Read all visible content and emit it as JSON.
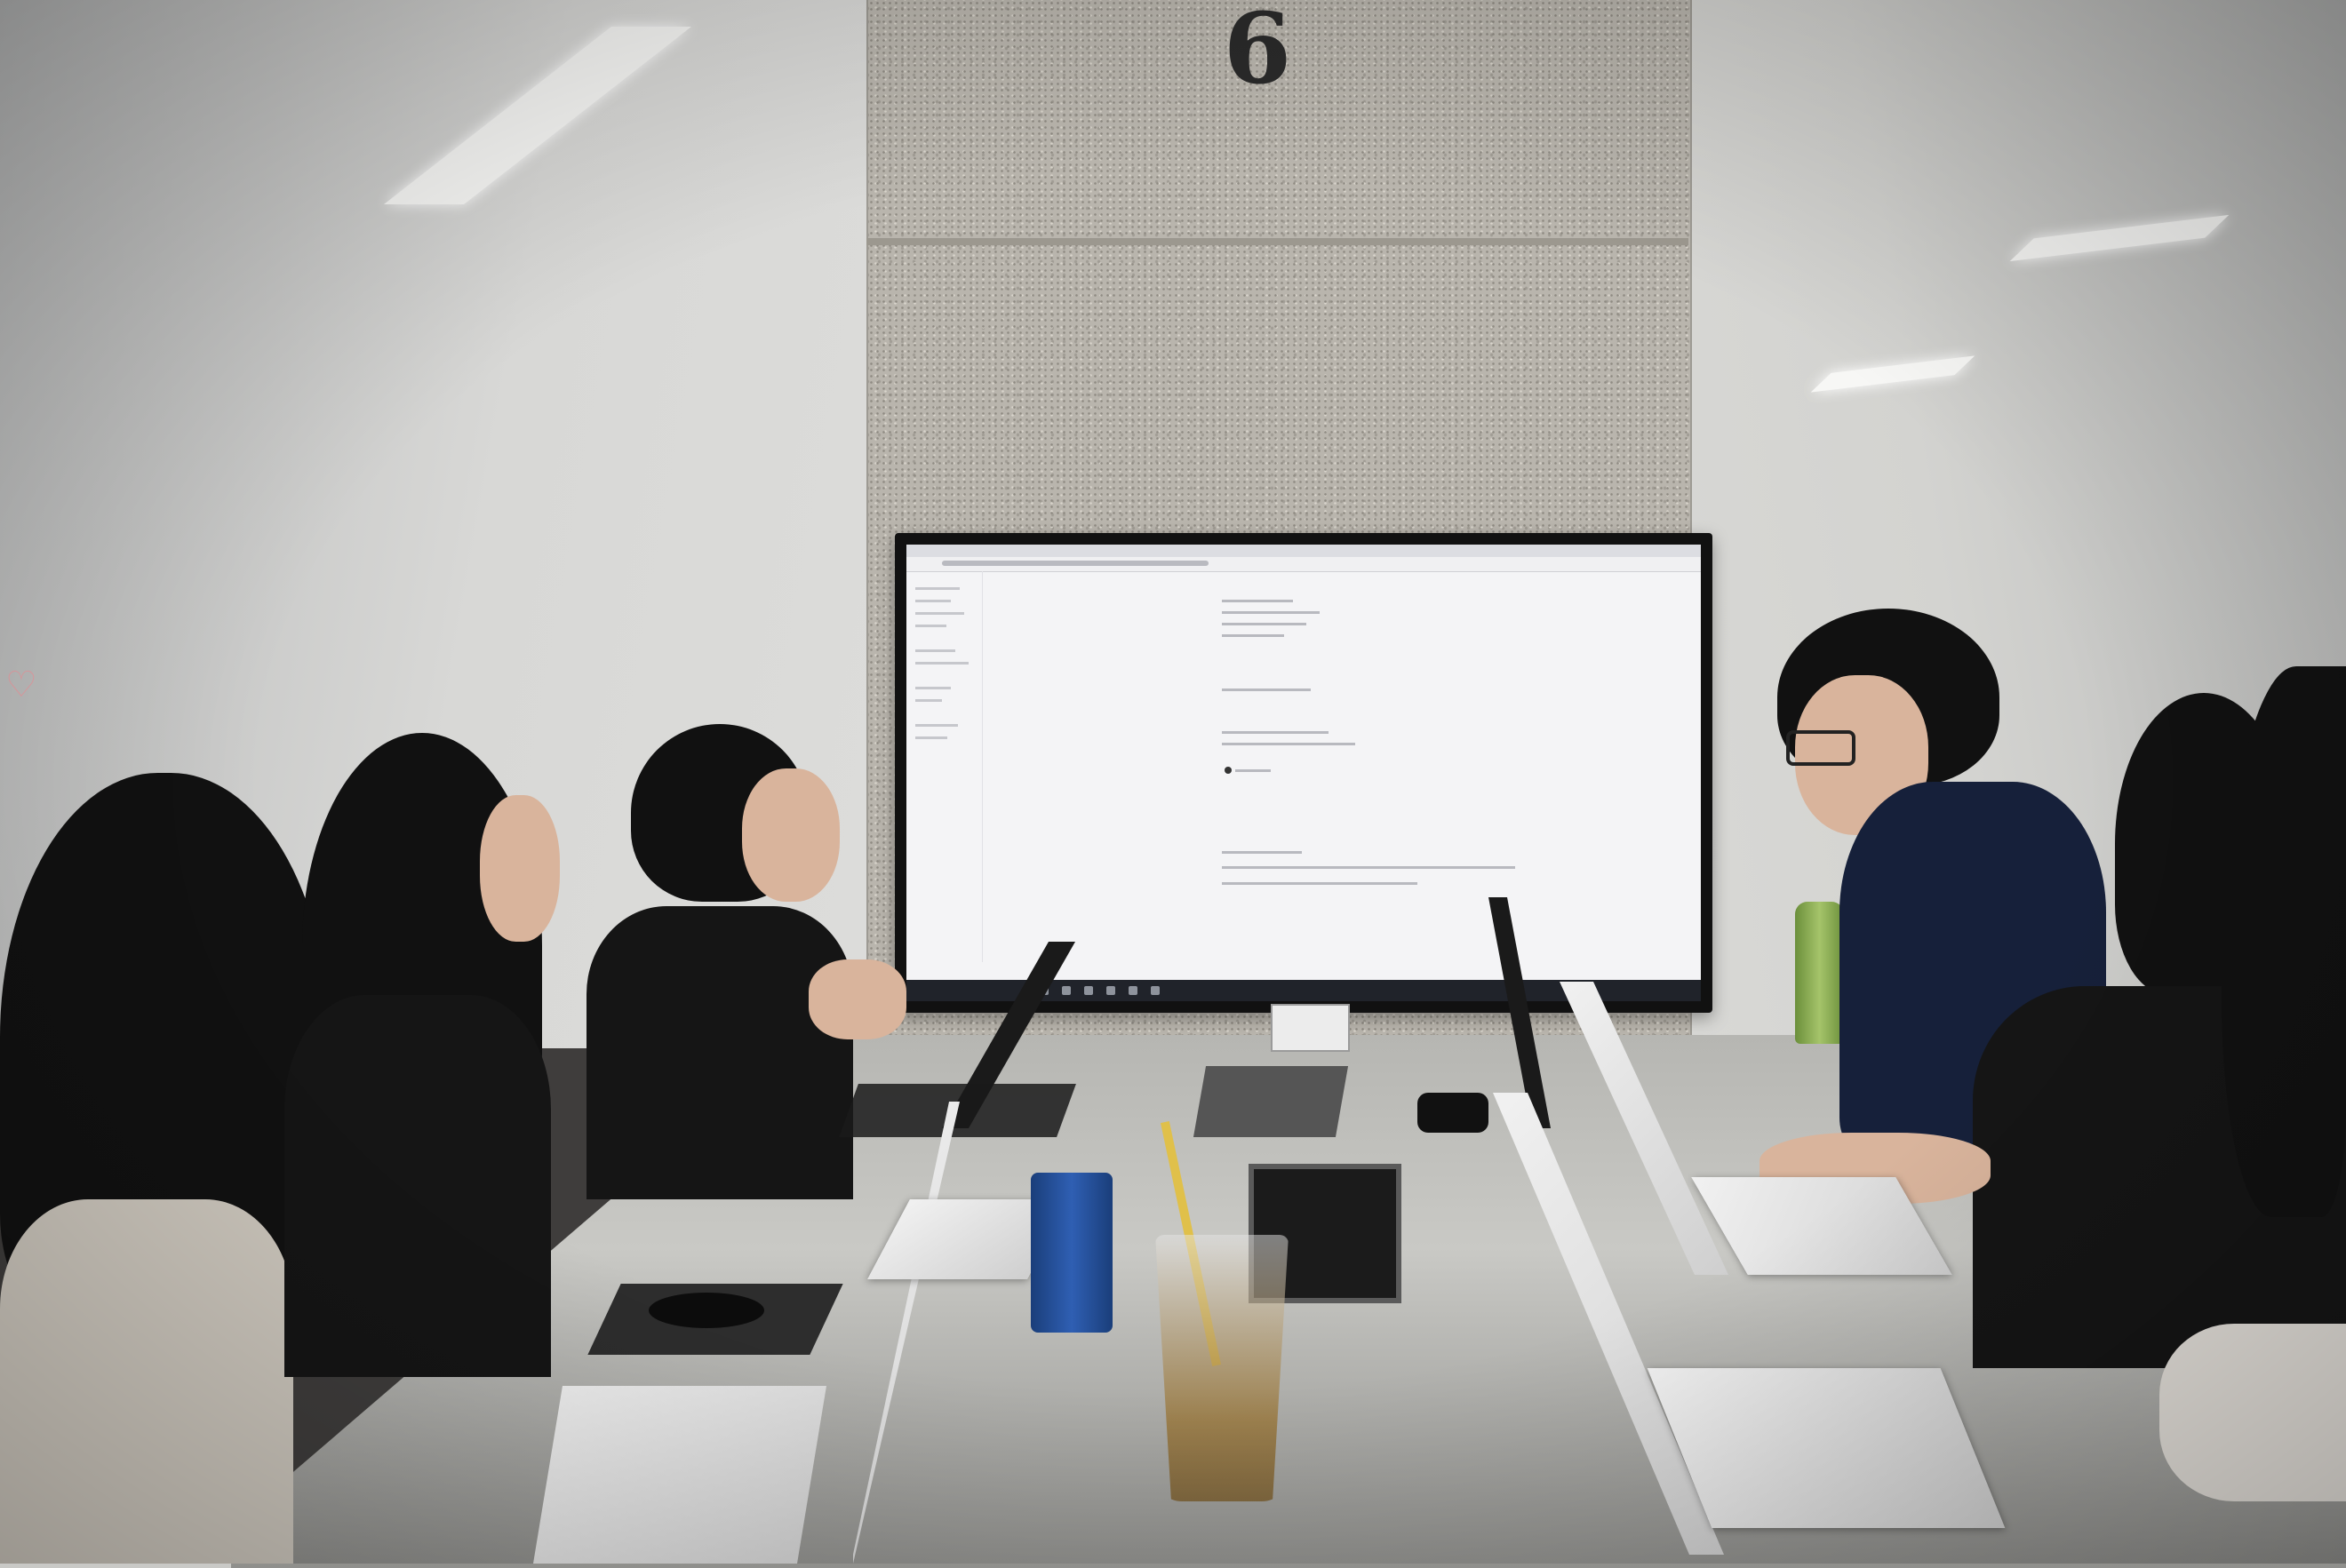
{
  "photo": {
    "scene": "meeting-room",
    "room_number": "6"
  },
  "colors": {
    "wall": "#d6d6d4",
    "pillar": "#b9b5ad",
    "tv_frame": "#111111",
    "screen": "#f4f4f6",
    "table": "#c2c2be"
  }
}
